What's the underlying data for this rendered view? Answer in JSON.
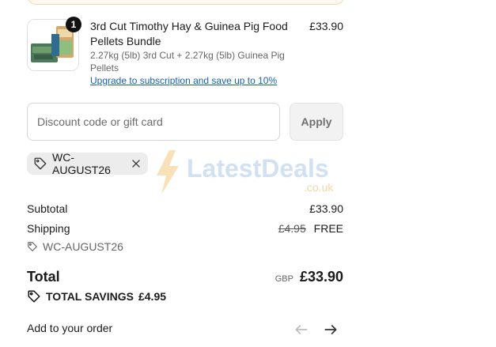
{
  "product": {
    "quantity_badge": "1",
    "name": "3rd Cut Timothy Hay & Guinea Pig Food Pellets Bundle",
    "variant": "2.27kg (5lb) 3rd Cut + 2.27kg (5lb) Guinea Pig Pellets",
    "upgrade_link": "Upgrade to subscription and save up to 10%",
    "price": "£33.90",
    "thumbnail_icon": "product-image"
  },
  "discount": {
    "placeholder": "Discount code or gift card",
    "apply_label": "Apply"
  },
  "applied_code": {
    "code": "WC-AUGUST26",
    "tag_icon": "tag-icon",
    "remove_icon": "close-icon"
  },
  "watermark": {
    "brand": "LatestDeals",
    "domain": ".co.uk"
  },
  "summary": {
    "subtotal_label": "Subtotal",
    "subtotal_value": "£33.90",
    "shipping_label": "Shipping",
    "shipping_original": "£4.95",
    "shipping_value": "FREE",
    "shipping_code": "WC-AUGUST26",
    "total_label": "Total",
    "currency": "GBP",
    "total_value": "£33.90",
    "savings_label": "TOTAL SAVINGS",
    "savings_value": "£4.95"
  },
  "add_to_order": {
    "label": "Add to your order",
    "prev_icon": "arrow-left-icon",
    "next_icon": "arrow-right-icon"
  },
  "colors": {
    "link": "#1660b8",
    "badge": "#111111",
    "apply_bg": "#f2f2f2",
    "chip_bg": "#ececec"
  }
}
